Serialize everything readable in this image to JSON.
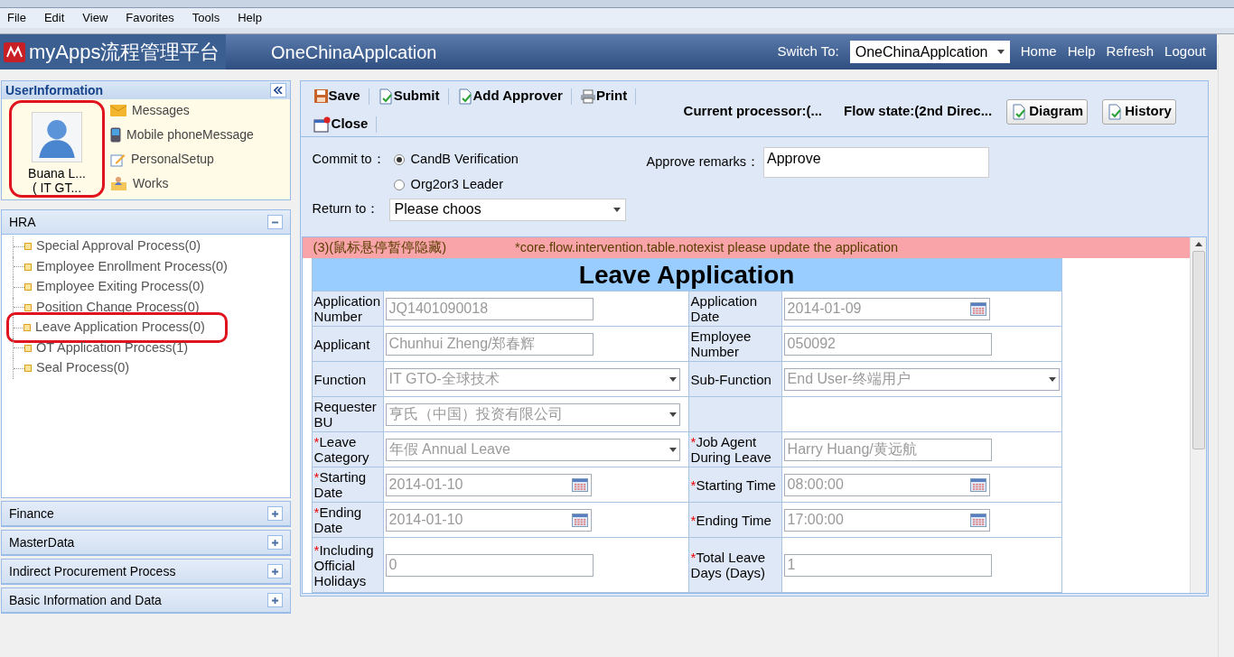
{
  "menubar": [
    "File",
    "Edit",
    "View",
    "Favorites",
    "Tools",
    "Help"
  ],
  "header": {
    "logo_text": "myApps流程管理平台",
    "app_title": "OneChinaApplcation",
    "switch_label": "Switch To:",
    "switch_value": "OneChinaApplcation",
    "links": [
      "Home",
      "Help",
      "Refresh",
      "Logout"
    ]
  },
  "user_panel": {
    "title": "UserInformation",
    "name": "Buana L...",
    "dept": "( IT GT...",
    "highlighted": true,
    "links": [
      {
        "label": "Messages",
        "kind": "mail"
      },
      {
        "label": "Mobile phoneMessage",
        "kind": "phone"
      },
      {
        "label": "PersonalSetup",
        "kind": "edit"
      },
      {
        "label": "Works",
        "kind": "works"
      }
    ]
  },
  "sections": [
    {
      "title": "HRA",
      "expanded": true,
      "items": [
        {
          "label": "Special Approval Process(0)",
          "highlighted": false
        },
        {
          "label": "Employee Enrollment Process(0)",
          "highlighted": false
        },
        {
          "label": "Employee Exiting Process(0)",
          "highlighted": false
        },
        {
          "label": "Position Change Process(0)",
          "highlighted": false
        },
        {
          "label": "Leave Application Process(0)",
          "highlighted": true
        },
        {
          "label": "OT Application Process(1)",
          "highlighted": false
        },
        {
          "label": "Seal Process(0)",
          "highlighted": false
        }
      ]
    },
    {
      "title": "Finance",
      "expanded": false
    },
    {
      "title": "MasterData",
      "expanded": false
    },
    {
      "title": "Indirect Procurement Process",
      "expanded": false
    },
    {
      "title": "Basic Information and Data",
      "expanded": false
    }
  ],
  "toolbar": {
    "buttons": [
      {
        "label": "Save",
        "kind": "save"
      },
      {
        "label": "Submit",
        "kind": "doc"
      },
      {
        "label": "Add Approver",
        "kind": "doc"
      },
      {
        "label": "Print",
        "kind": "print"
      },
      {
        "label": "Close",
        "kind": "close"
      }
    ],
    "current_processor": "Current processor:(...",
    "flow_state": "Flow state:(2nd Direc...",
    "actions": [
      "Diagram",
      "History"
    ]
  },
  "commit": {
    "label": "Commit to：",
    "options": [
      {
        "label": "CandB Verification",
        "selected": true
      },
      {
        "label": "Org2or3 Leader",
        "selected": false
      }
    ],
    "remarks_label": "Approve remarks：",
    "remarks_value": "Approve",
    "return_label": "Return to：",
    "return_value": "Please choos"
  },
  "notice": {
    "left": "(3)(鼠标悬停暂停隐藏)",
    "message": "*core.flow.intervention.table.notexist please update the application"
  },
  "form": {
    "title": "Leave Application",
    "rows": [
      [
        {
          "label": "Application Number",
          "field": {
            "kind": "text",
            "value": "JQ1401090018"
          }
        },
        {
          "label": "Application Date",
          "field": {
            "kind": "date",
            "value": "2014-01-09"
          }
        }
      ],
      [
        {
          "label": "Applicant",
          "field": {
            "kind": "text",
            "value": "Chunhui Zheng/郑春辉"
          }
        },
        {
          "label": "Employee Number",
          "field": {
            "kind": "text",
            "value": "050092"
          }
        }
      ],
      [
        {
          "label": "Function",
          "field": {
            "kind": "select",
            "value": "IT GTO-全球技术"
          }
        },
        {
          "label": "Sub-Function",
          "field": {
            "kind": "select",
            "value": "End User-终端用户"
          }
        }
      ],
      [
        {
          "label": "Requester BU",
          "field": {
            "kind": "select",
            "value": "亨氏（中国）投资有限公司"
          }
        },
        {
          "field": {
            "kind": "empty"
          }
        }
      ],
      [
        {
          "required_mark": "*",
          "label": "Leave Category",
          "field": {
            "kind": "select",
            "value": "年假 Annual Leave"
          }
        },
        {
          "required_mark": "*",
          "label": "Job Agent During Leave",
          "field": {
            "kind": "text",
            "value": "Harry Huang/黄远航"
          }
        }
      ],
      [
        {
          "required_mark": "*",
          "label": "Starting Date",
          "field": {
            "kind": "date",
            "value": "2014-01-10"
          }
        },
        {
          "required_mark": "*",
          "label": "Starting Time",
          "field": {
            "kind": "date",
            "value": "08:00:00"
          }
        }
      ],
      [
        {
          "required_mark": "*",
          "label": "Ending Date",
          "field": {
            "kind": "date",
            "value": "2014-01-10"
          }
        },
        {
          "required_mark": "*",
          "label": "Ending Time",
          "field": {
            "kind": "date",
            "value": "17:00:00"
          }
        }
      ],
      [
        {
          "required_mark": "*",
          "label": "Including Official Holidays",
          "field": {
            "kind": "text",
            "value": "0"
          }
        },
        {
          "required_mark": "*",
          "label": "Total Leave Days (Days)",
          "field": {
            "kind": "text",
            "value": "1"
          }
        }
      ]
    ]
  }
}
